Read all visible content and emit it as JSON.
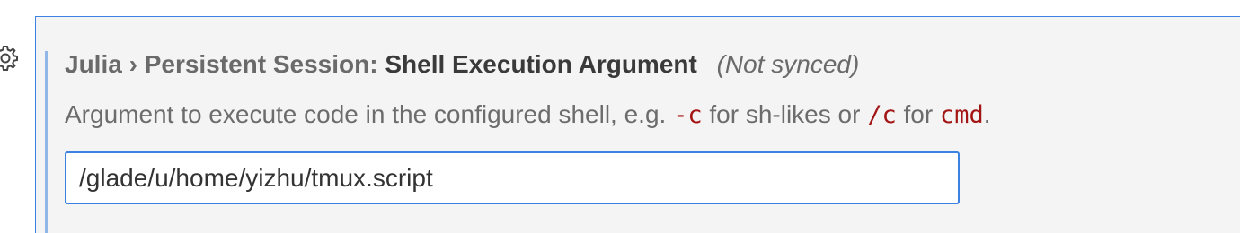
{
  "icons": {
    "gear": "gear-icon"
  },
  "colors": {
    "panel_background": "#f4f4f4",
    "focus_border": "#3c82e0",
    "code_text": "#a31515"
  },
  "setting": {
    "category": "Julia › Persistent Session:",
    "name": "Shell Execution Argument",
    "sync_status": "(Not synced)",
    "description": {
      "text_1": "Argument to execute code in the configured shell, e.g. ",
      "code_1": "-c",
      "text_2": " for sh-likes or ",
      "code_2": "/c",
      "text_3": " for ",
      "code_3": "cmd",
      "text_4": "."
    },
    "value": "/glade/u/home/yizhu/tmux.script"
  }
}
